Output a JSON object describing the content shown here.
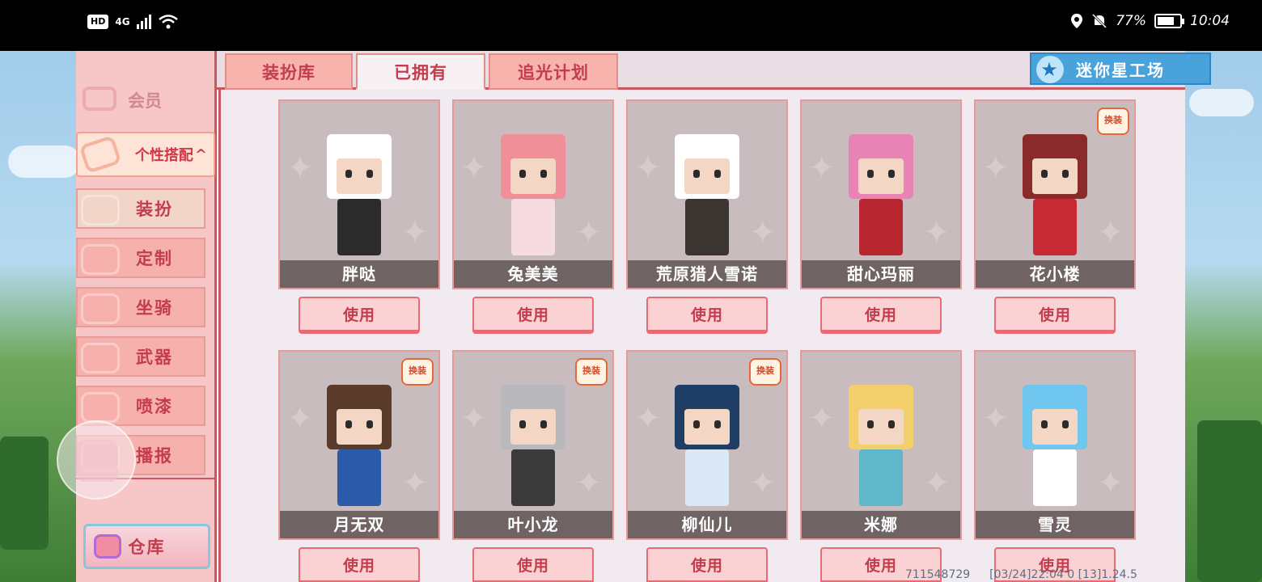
{
  "status_bar": {
    "network_badge": "HD",
    "signal_type": "4G",
    "battery_percent": "77%",
    "time": "10:04",
    "battery_level": 0.77,
    "icons": [
      "hd-icon",
      "signal-icon",
      "wifi-icon",
      "location-icon",
      "mute-bell-icon",
      "battery-icon"
    ]
  },
  "sidebar": {
    "vip_label": "会员",
    "group_label": "个性搭配",
    "items": [
      {
        "label": "装扮",
        "icon": "tshirt-icon",
        "active": true
      },
      {
        "label": "定制",
        "icon": "pencil-icon",
        "active": false
      },
      {
        "label": "坐骑",
        "icon": "mount-icon",
        "active": false
      },
      {
        "label": "武器",
        "icon": "gun-icon",
        "active": false
      },
      {
        "label": "喷漆",
        "icon": "spray-icon",
        "active": false
      },
      {
        "label": "播报",
        "icon": "broadcast-icon",
        "active": false
      }
    ],
    "warehouse_label": "仓库"
  },
  "tabs": [
    {
      "label": "装扮库",
      "active": false
    },
    {
      "label": "已拥有",
      "active": true
    },
    {
      "label": "追光计划",
      "active": false
    }
  ],
  "mini_workshop_label": "迷你星工场",
  "use_label": "使用",
  "badge_label": "换装",
  "skins": [
    {
      "name": "胖哒",
      "badge": false,
      "head": "#ffffff",
      "body": "#2b2b2b"
    },
    {
      "name": "兔美美",
      "badge": false,
      "head": "#f08e99",
      "body": "#f6dbe0"
    },
    {
      "name": "荒原猎人雪诺",
      "badge": false,
      "head": "#ffffff",
      "body": "#3a3530"
    },
    {
      "name": "甜心玛丽",
      "badge": false,
      "head": "#e884b4",
      "body": "#b8272f"
    },
    {
      "name": "花小楼",
      "badge": true,
      "head": "#8b2a2a",
      "body": "#c72a33"
    },
    {
      "name": "月无双",
      "badge": true,
      "head": "#5a3a2a",
      "body": "#2a5aa8"
    },
    {
      "name": "叶小龙",
      "badge": true,
      "head": "#b9b9bd",
      "body": "#3a3a3a"
    },
    {
      "name": "柳仙儿",
      "badge": true,
      "head": "#1e3e66",
      "body": "#dbe9f7"
    },
    {
      "name": "米娜",
      "badge": false,
      "head": "#f2cf6a",
      "body": "#5fb7c9"
    },
    {
      "name": "雪灵",
      "badge": false,
      "head": "#6fc7ef",
      "body": "#ffffff"
    }
  ],
  "footer": {
    "uid": "711548729",
    "build_info": "[03/24]22:04 0 [13]1.24.5"
  },
  "colors": {
    "accent_red": "#c43d4f",
    "sidebar_bg": "#f7c6c7",
    "workshop_blue": "#4aa2db"
  }
}
